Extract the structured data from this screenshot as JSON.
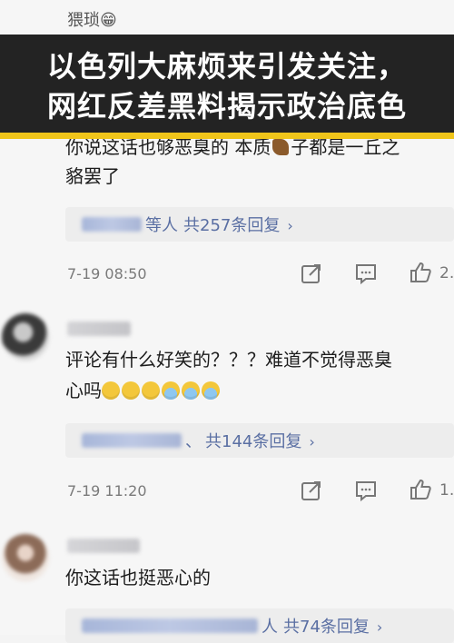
{
  "top_comment": {
    "username": "猥琐😁"
  },
  "banner": {
    "line1": "以色列大麻烦来引发关注，",
    "line2": "网红反差黑料揭示政治底色"
  },
  "comment1": {
    "text_line1": "你说这话也够恶臭的 本质",
    "text_line1_tail": "子都是一丘之",
    "text_line2": "貉罢了",
    "reply_suffix": "等人",
    "reply_count": "共257条回复",
    "time": "7-19 08:50",
    "likes": "2."
  },
  "comment2": {
    "text_line1": "评论有什么好笑的？？？难道不觉得恶臭",
    "text_line2": "心吗",
    "reply_suffix": "、",
    "reply_count": "共144条回复",
    "time": "7-19 11:20",
    "likes": "1."
  },
  "comment3": {
    "text_line1": "你这话也挺恶心的",
    "reply_suffix": "人",
    "reply_count": "共74条回复"
  },
  "icons": {
    "share": "share-icon",
    "comment": "comment-icon",
    "like": "thumbs-up-icon",
    "chevron": "chevron-right-icon"
  },
  "colors": {
    "banner_bg": "#121212",
    "accent_bar": "#f0c51a",
    "reply_link": "#5a6fa3"
  }
}
